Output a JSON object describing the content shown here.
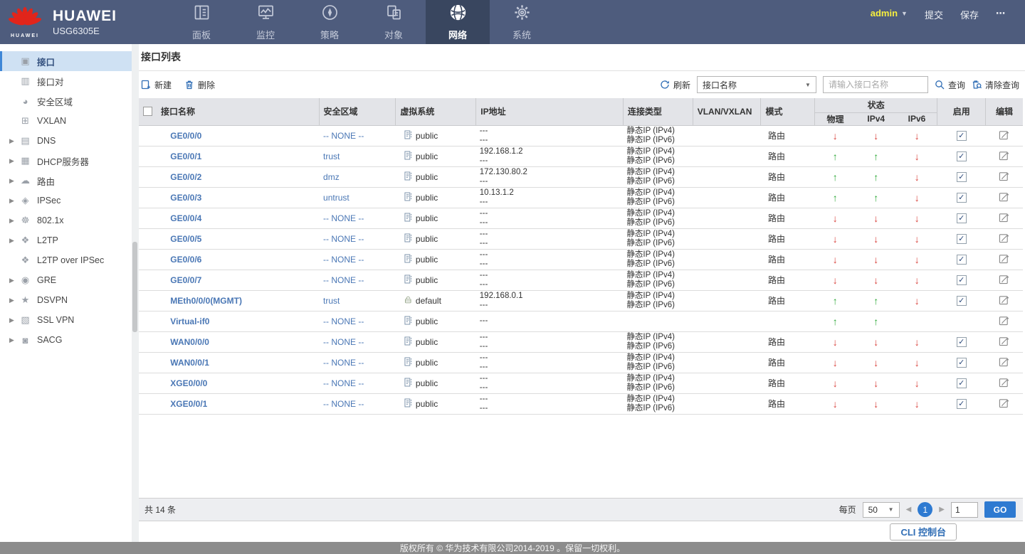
{
  "header": {
    "brand": {
      "logo": "huawei-flower-logo",
      "logo_caption": "HUAWEI",
      "product": "HUAWEI",
      "model": "USG6305E"
    },
    "nav": [
      {
        "label": "面板",
        "icon": "dashboard-icon",
        "active": false
      },
      {
        "label": "监控",
        "icon": "monitor-icon",
        "active": false
      },
      {
        "label": "策略",
        "icon": "policy-icon",
        "active": false
      },
      {
        "label": "对象",
        "icon": "object-icon",
        "active": false
      },
      {
        "label": "网络",
        "icon": "network-icon",
        "active": true
      },
      {
        "label": "系统",
        "icon": "system-icon",
        "active": false
      }
    ],
    "user": {
      "name": "admin"
    },
    "actions": {
      "commit": "提交",
      "save": "保存",
      "more": "⋯"
    }
  },
  "sidebar": {
    "items": [
      {
        "label": "接口",
        "icon": "interface-icon",
        "expandable": false,
        "selected": true
      },
      {
        "label": "接口对",
        "icon": "interface-pair-icon",
        "expandable": false,
        "selected": false
      },
      {
        "label": "安全区域",
        "icon": "security-zone-icon",
        "expandable": false,
        "selected": false
      },
      {
        "label": "VXLAN",
        "icon": "vxlan-icon",
        "expandable": false,
        "selected": false
      },
      {
        "label": "DNS",
        "icon": "dns-icon",
        "expandable": true,
        "selected": false
      },
      {
        "label": "DHCP服务器",
        "icon": "dhcp-server-icon",
        "expandable": true,
        "selected": false
      },
      {
        "label": "路由",
        "icon": "route-icon",
        "expandable": true,
        "selected": false
      },
      {
        "label": "IPSec",
        "icon": "ipsec-icon",
        "expandable": true,
        "selected": false
      },
      {
        "label": "802.1x",
        "icon": "dot1x-icon",
        "expandable": true,
        "selected": false
      },
      {
        "label": "L2TP",
        "icon": "l2tp-icon",
        "expandable": true,
        "selected": false
      },
      {
        "label": "L2TP over IPSec",
        "icon": "l2tp-over-ipsec-icon",
        "expandable": false,
        "selected": false
      },
      {
        "label": "GRE",
        "icon": "gre-icon",
        "expandable": true,
        "selected": false
      },
      {
        "label": "DSVPN",
        "icon": "dsvpn-icon",
        "expandable": true,
        "selected": false
      },
      {
        "label": "SSL VPN",
        "icon": "ssl-vpn-icon",
        "expandable": true,
        "selected": false
      },
      {
        "label": "SACG",
        "icon": "sacg-icon",
        "expandable": true,
        "selected": false
      }
    ]
  },
  "main": {
    "title": "接口列表",
    "toolbar": {
      "new_label": "新建",
      "delete_label": "删除",
      "refresh_label": "刷新",
      "filter_selected": "接口名称",
      "search_placeholder": "请输入接口名称",
      "query_label": "查询",
      "clear_query_label": "清除查询"
    },
    "table": {
      "columns": {
        "name": "接口名称",
        "zone": "安全区域",
        "vsys": "虚拟系统",
        "ip": "IP地址",
        "conn": "连接类型",
        "vlan": "VLAN/VXLAN",
        "mode": "模式",
        "status": "状态",
        "status_sub": [
          "物理",
          "IPv4",
          "IPv6"
        ],
        "enable": "启用",
        "edit": "编辑"
      },
      "rows": [
        {
          "name": "GE0/0/0",
          "zone": "-- NONE --",
          "vsys": "public",
          "ip": [
            "---",
            "---"
          ],
          "conn": [
            "静态IP (IPv4)",
            "静态IP (IPv6)"
          ],
          "vlan": "",
          "mode": "路由",
          "status": {
            "physical": "down",
            "ipv4": "down",
            "ipv6": "down"
          },
          "enabled": true
        },
        {
          "name": "GE0/0/1",
          "zone": "trust",
          "vsys": "public",
          "ip": [
            "192.168.1.2",
            "---"
          ],
          "conn": [
            "静态IP (IPv4)",
            "静态IP (IPv6)"
          ],
          "vlan": "",
          "mode": "路由",
          "status": {
            "physical": "up",
            "ipv4": "up",
            "ipv6": "down"
          },
          "enabled": true
        },
        {
          "name": "GE0/0/2",
          "zone": "dmz",
          "vsys": "public",
          "ip": [
            "172.130.80.2",
            "---"
          ],
          "conn": [
            "静态IP (IPv4)",
            "静态IP (IPv6)"
          ],
          "vlan": "",
          "mode": "路由",
          "status": {
            "physical": "up",
            "ipv4": "up",
            "ipv6": "down"
          },
          "enabled": true
        },
        {
          "name": "GE0/0/3",
          "zone": "untrust",
          "vsys": "public",
          "ip": [
            "10.13.1.2",
            "---"
          ],
          "conn": [
            "静态IP (IPv4)",
            "静态IP (IPv6)"
          ],
          "vlan": "",
          "mode": "路由",
          "status": {
            "physical": "up",
            "ipv4": "up",
            "ipv6": "down"
          },
          "enabled": true
        },
        {
          "name": "GE0/0/4",
          "zone": "-- NONE --",
          "vsys": "public",
          "ip": [
            "---",
            "---"
          ],
          "conn": [
            "静态IP (IPv4)",
            "静态IP (IPv6)"
          ],
          "vlan": "",
          "mode": "路由",
          "status": {
            "physical": "down",
            "ipv4": "down",
            "ipv6": "down"
          },
          "enabled": true
        },
        {
          "name": "GE0/0/5",
          "zone": "-- NONE --",
          "vsys": "public",
          "ip": [
            "---",
            "---"
          ],
          "conn": [
            "静态IP (IPv4)",
            "静态IP (IPv6)"
          ],
          "vlan": "",
          "mode": "路由",
          "status": {
            "physical": "down",
            "ipv4": "down",
            "ipv6": "down"
          },
          "enabled": true
        },
        {
          "name": "GE0/0/6",
          "zone": "-- NONE --",
          "vsys": "public",
          "ip": [
            "---",
            "---"
          ],
          "conn": [
            "静态IP (IPv4)",
            "静态IP (IPv6)"
          ],
          "vlan": "",
          "mode": "路由",
          "status": {
            "physical": "down",
            "ipv4": "down",
            "ipv6": "down"
          },
          "enabled": true
        },
        {
          "name": "GE0/0/7",
          "zone": "-- NONE --",
          "vsys": "public",
          "ip": [
            "---",
            "---"
          ],
          "conn": [
            "静态IP (IPv4)",
            "静态IP (IPv6)"
          ],
          "vlan": "",
          "mode": "路由",
          "status": {
            "physical": "down",
            "ipv4": "down",
            "ipv6": "down"
          },
          "enabled": true
        },
        {
          "name": "MEth0/0/0(MGMT)",
          "zone": "trust",
          "vsys": "default",
          "ip": [
            "192.168.0.1",
            "---"
          ],
          "conn": [
            "静态IP (IPv4)",
            "静态IP (IPv6)"
          ],
          "vlan": "",
          "mode": "路由",
          "status": {
            "physical": "up",
            "ipv4": "up",
            "ipv6": "down"
          },
          "enabled": true
        },
        {
          "name": "Virtual-if0",
          "zone": "-- NONE --",
          "vsys": "public",
          "ip": [
            "---"
          ],
          "conn": [],
          "vlan": "",
          "mode": "",
          "status": {
            "physical": "up",
            "ipv4": "up",
            "ipv6": ""
          },
          "enabled": null
        },
        {
          "name": "WAN0/0/0",
          "zone": "-- NONE --",
          "vsys": "public",
          "ip": [
            "---",
            "---"
          ],
          "conn": [
            "静态IP (IPv4)",
            "静态IP (IPv6)"
          ],
          "vlan": "",
          "mode": "路由",
          "status": {
            "physical": "down",
            "ipv4": "down",
            "ipv6": "down"
          },
          "enabled": true
        },
        {
          "name": "WAN0/0/1",
          "zone": "-- NONE --",
          "vsys": "public",
          "ip": [
            "---",
            "---"
          ],
          "conn": [
            "静态IP (IPv4)",
            "静态IP (IPv6)"
          ],
          "vlan": "",
          "mode": "路由",
          "status": {
            "physical": "down",
            "ipv4": "down",
            "ipv6": "down"
          },
          "enabled": true
        },
        {
          "name": "XGE0/0/0",
          "zone": "-- NONE --",
          "vsys": "public",
          "ip": [
            "---",
            "---"
          ],
          "conn": [
            "静态IP (IPv4)",
            "静态IP (IPv6)"
          ],
          "vlan": "",
          "mode": "路由",
          "status": {
            "physical": "down",
            "ipv4": "down",
            "ipv6": "down"
          },
          "enabled": true
        },
        {
          "name": "XGE0/0/1",
          "zone": "-- NONE --",
          "vsys": "public",
          "ip": [
            "---",
            "---"
          ],
          "conn": [
            "静态IP (IPv4)",
            "静态IP (IPv6)"
          ],
          "vlan": "",
          "mode": "路由",
          "status": {
            "physical": "down",
            "ipv4": "down",
            "ipv6": "down"
          },
          "enabled": true
        }
      ]
    },
    "pagination": {
      "total": "共 14 条",
      "per_page_label": "每页",
      "per_page": "50",
      "current_page": "1",
      "goto_value": "1",
      "go_label": "GO"
    },
    "cli_button": "CLI 控制台"
  },
  "footer": {
    "copyright": "版权所有 © 华为技术有限公司2014-2019 。保留一切权利。"
  },
  "colors": {
    "topbar": "#4e5c7d",
    "topbar_active": "#39465f",
    "accent_blue": "#2f6db5",
    "link_blue": "#4a77b5",
    "selected_item_bg": "#cfe1f3",
    "selected_item_border": "#3f87d7",
    "status_up_green": "#2ea838",
    "status_down_red": "#d8403a",
    "pagination_blue": "#2e7ad1",
    "admin_yellow": "#f7ef3e",
    "table_header_bg": "#e3e4e8",
    "footer_bg": "#8c8c8c"
  }
}
